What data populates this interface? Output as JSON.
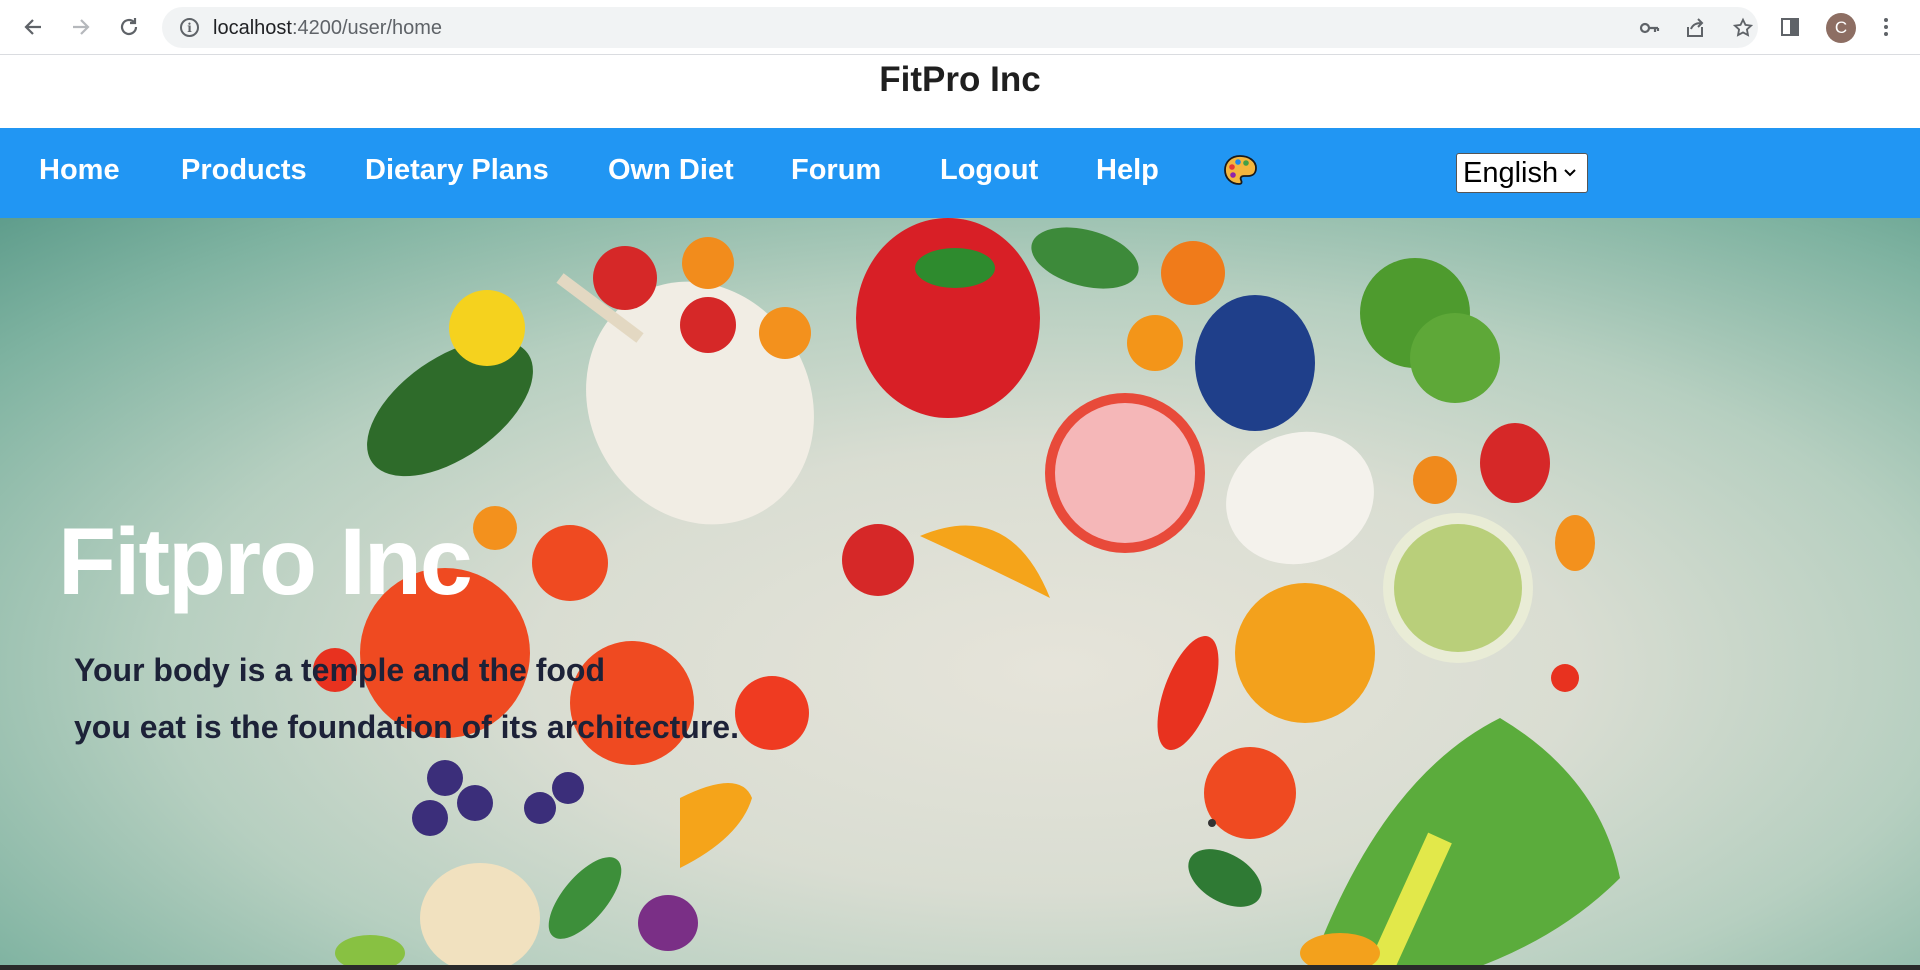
{
  "browser": {
    "url_host": "localhost",
    "url_path": ":4200/user/home",
    "avatar_letter": "C"
  },
  "site": {
    "title": "FitPro Inc"
  },
  "nav": {
    "items": [
      {
        "label": "Home"
      },
      {
        "label": "Products"
      },
      {
        "label": "Dietary Plans"
      },
      {
        "label": "Own Diet"
      },
      {
        "label": "Forum"
      },
      {
        "label": "Logout"
      },
      {
        "label": "Help"
      }
    ],
    "language": {
      "selected": "English"
    }
  },
  "hero": {
    "title": "Fitpro Inc",
    "line1": "Your body is a temple and the food",
    "line2": "you eat is the foundation of its architecture."
  },
  "colors": {
    "navbar": "#2196f3",
    "hero_text": "#1d2238"
  }
}
